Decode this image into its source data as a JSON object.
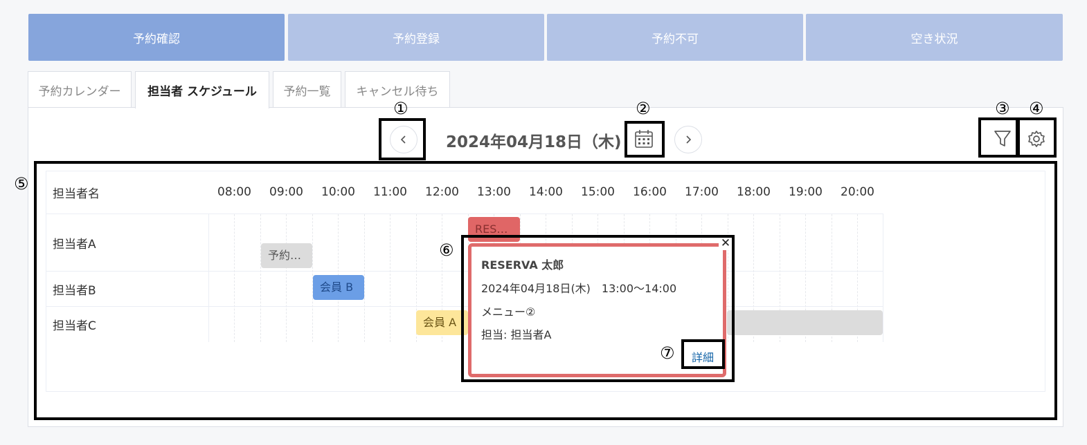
{
  "top_tabs": [
    {
      "label": "予約確認",
      "active": true
    },
    {
      "label": "予約登録",
      "active": false
    },
    {
      "label": "予約不可",
      "active": false
    },
    {
      "label": "空き状況",
      "active": false
    }
  ],
  "sub_tabs": [
    {
      "label": "予約カレンダー",
      "active": false
    },
    {
      "label": "担当者 スケジュール",
      "active": true
    },
    {
      "label": "予約一覧",
      "active": false
    },
    {
      "label": "キャンセル待ち",
      "active": false
    }
  ],
  "toolbar": {
    "date": "2024年04月18日（木)"
  },
  "annotations": [
    "①",
    "②",
    "③",
    "④",
    "⑤",
    "⑥",
    "⑦"
  ],
  "schedule": {
    "header_label": "担当者名",
    "hours": [
      "08:00",
      "09:00",
      "10:00",
      "11:00",
      "12:00",
      "13:00",
      "14:00",
      "15:00",
      "16:00",
      "17:00",
      "18:00",
      "19:00",
      "20:00"
    ],
    "staff": [
      "担当者A",
      "担当者B",
      "担当者C"
    ],
    "events": [
      {
        "label": "RES…",
        "staff": "担当者A"
      },
      {
        "label": "予約…",
        "staff": "担当者A"
      },
      {
        "label": "会員 B",
        "staff": "担当者B"
      },
      {
        "label": "会員 A",
        "staff": "担当者C"
      }
    ]
  },
  "popup": {
    "name": "RESERVA 太郎",
    "datetime": "2024年04月18日(木)　13:00〜14:00",
    "menu": "メニュー②",
    "staff": "担当: 担当者A",
    "detail_link": "詳細",
    "close_glyph": "✕"
  },
  "colors": {
    "tab_active": "#86a5dc",
    "tab_inactive": "#b2c3e6",
    "event_red": "#e06666",
    "event_gray": "#dcdcdc",
    "event_blue": "#6b9ee6",
    "event_yellow": "#fde69a",
    "popup_border": "#df6b6b",
    "link": "#1565a8"
  }
}
